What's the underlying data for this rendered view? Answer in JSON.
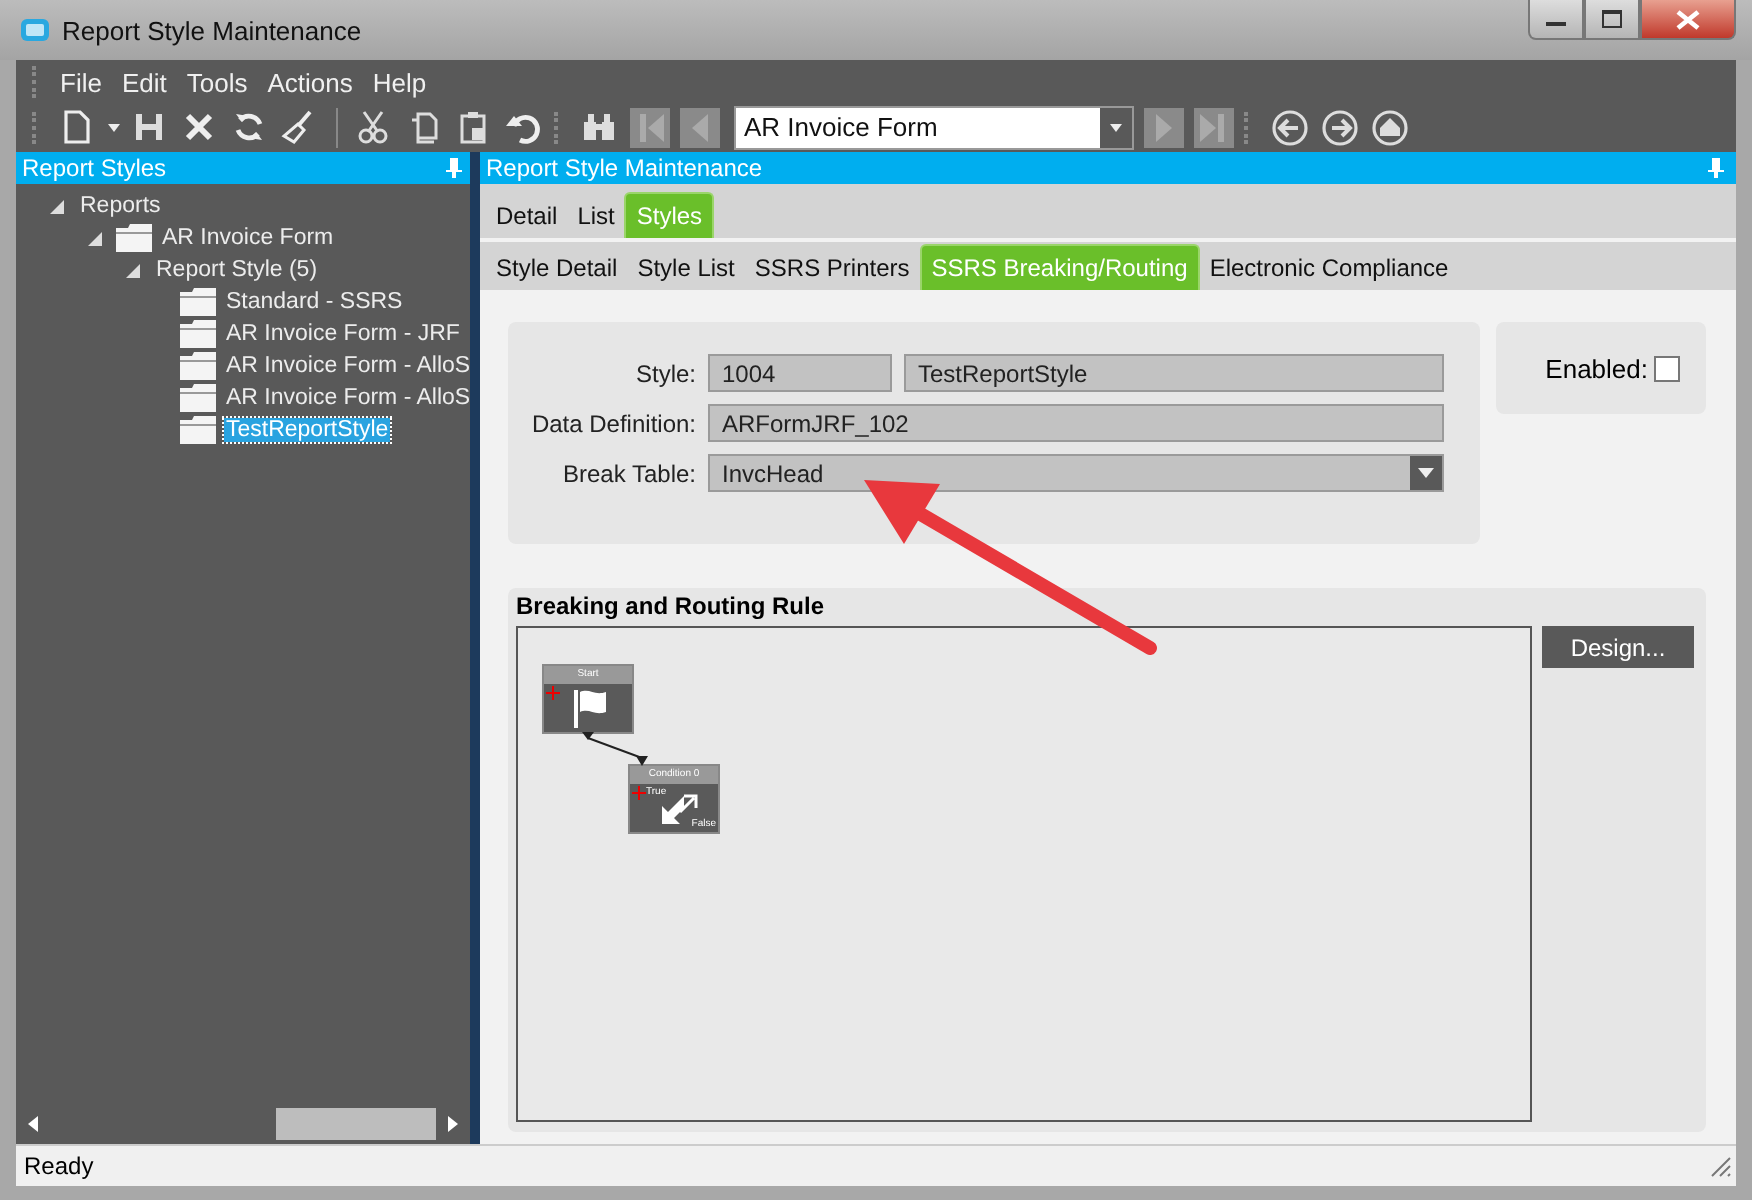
{
  "window": {
    "title": "Report Style Maintenance"
  },
  "menu": [
    "File",
    "Edit",
    "Tools",
    "Actions",
    "Help"
  ],
  "toolbar": {
    "record_selector": "AR Invoice Form"
  },
  "left_panel": {
    "title": "Report Styles",
    "tree": [
      {
        "label": "Reports",
        "expanded": true,
        "selected": false,
        "children": [
          {
            "label": "AR Invoice Form",
            "kind": "folder",
            "expanded": true,
            "selected": false,
            "children": [
              {
                "label": "Report Style (5)",
                "expanded": true,
                "selected": false,
                "children": [
                  {
                    "label": "Standard - SSRS",
                    "kind": "folder",
                    "selected": false
                  },
                  {
                    "label": "AR Invoice Form - JRF",
                    "kind": "folder",
                    "selected": false
                  },
                  {
                    "label": "AR Invoice Form - AlloS",
                    "kind": "folder",
                    "selected": false
                  },
                  {
                    "label": "AR Invoice Form - AlloS",
                    "kind": "folder",
                    "selected": false
                  },
                  {
                    "label": "TestReportStyle",
                    "kind": "folder",
                    "selected": true
                  }
                ]
              }
            ]
          }
        ]
      }
    ]
  },
  "main_panel": {
    "title": "Report Style Maintenance",
    "tabs": [
      {
        "label": "Detail",
        "selected": false
      },
      {
        "label": "List",
        "selected": false
      },
      {
        "label": "Styles",
        "selected": true
      }
    ],
    "subtabs": [
      {
        "label": "Style Detail",
        "selected": false
      },
      {
        "label": "Style List",
        "selected": false
      },
      {
        "label": "SSRS Printers",
        "selected": false
      },
      {
        "label": "SSRS Breaking/Routing",
        "selected": true
      },
      {
        "label": "Electronic Compliance",
        "selected": false
      }
    ],
    "form": {
      "style_label": "Style:",
      "style_id": "1004",
      "style_name": "TestReportStyle",
      "data_definition_label": "Data Definition:",
      "data_definition": "ARFormJRF_102",
      "break_table_label": "Break Table:",
      "break_table": "InvcHead",
      "enabled_label": "Enabled:",
      "enabled": false
    },
    "rule": {
      "title": "Breaking and Routing Rule",
      "design_button": "Design...",
      "nodes": [
        {
          "kind": "start",
          "title": "Start"
        },
        {
          "kind": "condition",
          "title": "Condition 0",
          "true_label": "True",
          "false_label": "False"
        }
      ]
    }
  },
  "status_bar": "Ready"
}
